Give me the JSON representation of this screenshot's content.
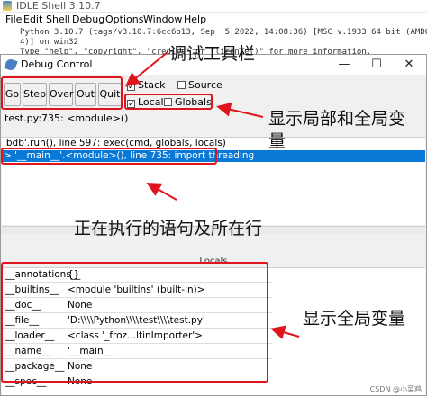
{
  "shell": {
    "title": "IDLE Shell 3.10.7",
    "menu": [
      "File",
      "Edit",
      "Shell",
      "Debug",
      "Options",
      "Window",
      "Help"
    ],
    "lines": [
      "Python 3.10.7 (tags/v3.10.7:6cc6b13, Sep  5 2022, 14:08:36) [MSC v.1933 64 bit (AMD6",
      "4)] on win32",
      "Type \"help\", \"copyright\", \"credits\" or \"license()\" for more information."
    ]
  },
  "debug": {
    "title": "Debug Control",
    "buttons": [
      "Go",
      "Step",
      "Over",
      "Out",
      "Quit"
    ],
    "checks": {
      "stack": {
        "label": "Stack",
        "checked": true
      },
      "source": {
        "label": "Source",
        "checked": false
      },
      "locals": {
        "label": "Locals",
        "checked": true
      },
      "globals": {
        "label": "Globals",
        "checked": false
      }
    },
    "status": "test.py:735: <module>()",
    "stack": [
      "'bdb'.run(), line 597: exec(cmd, globals, locals)",
      "> '__main__'.<module>(), line 735: import threading"
    ],
    "locals_header": "Locals",
    "locals": [
      {
        "name": "__annotations__",
        "value": "{}"
      },
      {
        "name": "__builtins__",
        "value": "<module 'builtins' (built-in)>"
      },
      {
        "name": "__doc__",
        "value": "None"
      },
      {
        "name": "__file__",
        "value": "'D:\\\\\\\\Python\\\\\\\\test\\\\\\\\test.py'"
      },
      {
        "name": "__loader__",
        "value": "<class '_froz...ltinImporter'>"
      },
      {
        "name": "__name__",
        "value": "'__main__'"
      },
      {
        "name": "__package__",
        "value": "None"
      },
      {
        "name": "__spec__",
        "value": "None"
      }
    ]
  },
  "annotations": {
    "toolbar": "调试工具栏",
    "locals_globals": "显示局部和全局变量",
    "current_line": "正在执行的语句及所在行",
    "globals": "显示全局变量"
  },
  "watermark": "CSDN @小菜鸡",
  "colors": {
    "highlight": "#0a78d7",
    "annotation_red": "#e0141c"
  }
}
